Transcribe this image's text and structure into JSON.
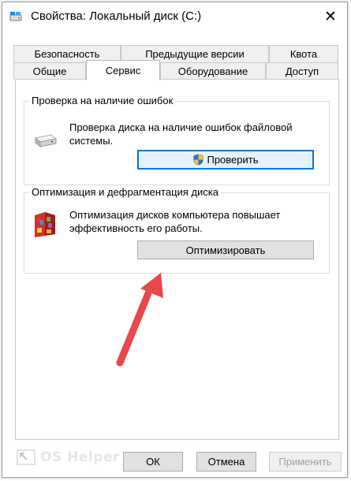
{
  "window": {
    "title": "Свойства: Локальный диск (C:)",
    "icons": {
      "drive": "drive-icon",
      "close": "close-icon"
    }
  },
  "tabs": {
    "row1": [
      "Безопасность",
      "Предыдущие версии",
      "Квота"
    ],
    "row2": [
      "Общие",
      "Сервис",
      "Оборудование",
      "Доступ"
    ],
    "active": "Сервис"
  },
  "error_check": {
    "group_label": "Проверка на наличие ошибок",
    "description_line1": "Проверка диска на наличие ошибок файловой",
    "description_line2": "системы.",
    "button_label": "Проверить",
    "icons": {
      "group": "disk-drive-icon",
      "button": "uac-shield-icon"
    }
  },
  "optimize": {
    "group_label": "Оптимизация и дефрагментация диска",
    "description_line1": "Оптимизация дисков компьютера повышает",
    "description_line2": "эффективность его работы.",
    "button_label": "Оптимизировать",
    "icons": {
      "group": "defrag-icon"
    }
  },
  "footer": {
    "ok_label": "ОК",
    "cancel_label": "Отмена",
    "apply_label": "Применить",
    "watermark_text": "OS Helper"
  },
  "colors": {
    "accent": "#0078d7",
    "annotation_arrow": "#e8474b"
  }
}
